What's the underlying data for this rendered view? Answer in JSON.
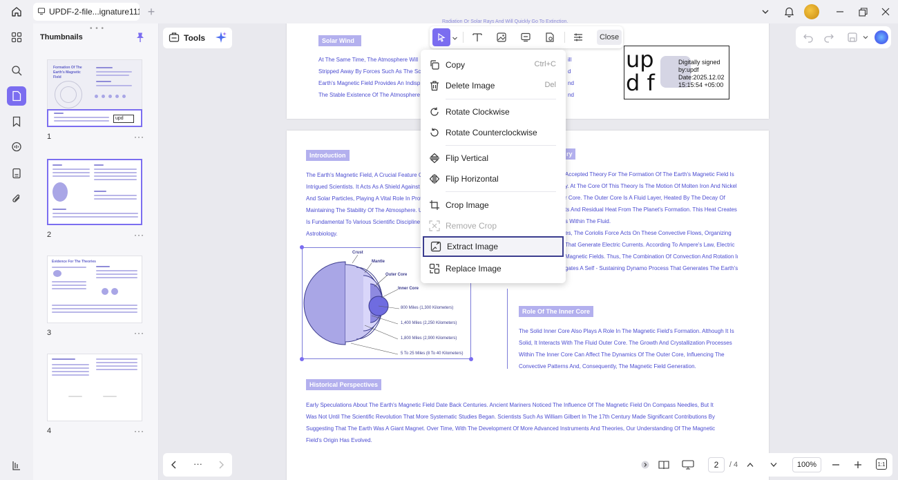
{
  "titlebar": {
    "tab_title": "UPDF-2-file...ignature111"
  },
  "thumbnails": {
    "title": "Thumbnails",
    "pages": [
      {
        "num": "1",
        "more": "···"
      },
      {
        "num": "2",
        "more": "···"
      },
      {
        "num": "3",
        "more": "···"
      },
      {
        "num": "4",
        "more": "···"
      }
    ],
    "thumb_texts": {
      "p1_title": "Formation Of The Earth's Magnetic Field",
      "p1_sig": "upd",
      "p3_title": "Evidence For The Theories"
    }
  },
  "tools": {
    "label": "Tools"
  },
  "edit_toolbar": {
    "close_label": "Close"
  },
  "context_menu": {
    "items": [
      {
        "label": "Copy",
        "shortcut": "Ctrl+C"
      },
      {
        "label": "Delete Image",
        "shortcut": "Del"
      },
      {
        "label": "Rotate Clockwise"
      },
      {
        "label": "Rotate Counterclockwise"
      },
      {
        "label": "Flip Vertical"
      },
      {
        "label": "Flip Horizontal"
      },
      {
        "label": "Crop Image"
      },
      {
        "label": "Remove Crop"
      },
      {
        "label": "Extract Image"
      },
      {
        "label": "Replace Image"
      }
    ]
  },
  "document": {
    "page1": {
      "heading": "Solar Wind",
      "top_fragment": "Radiation Or Solar Rays And Will Quickly Go To Extinction.",
      "lines": [
        "At The Same Time, The Atmosphere Will",
        "Stripped Away By Forces Such As The Sc",
        "Earth's Magnetic Field Provides An Indisp",
        "The Stable Existence Of The Atmosphere"
      ],
      "right_fragments": [
        "ill",
        "d",
        "nd",
        "nd"
      ]
    },
    "signature": {
      "updf": "upd f",
      "line1": "Digitally signed",
      "line2": "by:updf",
      "line3": "Date:2025.12.02",
      "line4": "15:15:54 +05:00"
    },
    "page2": {
      "intro_heading": "Introduction",
      "intro_lines": [
        "The Earth's Magnetic Field, A Crucial Feature C",
        "Intrigued Scientists. It Acts As A Shield Against",
        "And Solar Particles, Playing A Vital Role In Prote",
        "Maintaining The Stability Of The Atmosphere. U",
        "Is Fundamental To Various Scientific Discipline",
        "Astrobiology."
      ],
      "theory_heading_fragment": "ry",
      "theory_lines": [
        "Accepted Theory For The Formation Of The Earth's Magnetic Field Is",
        "y. At The Core Of This Theory Is The Motion Of Molten Iron And Nickel",
        "r Core. The Outer Core Is A Fluid Layer, Heated By The Decay Of",
        "ts And Residual Heat From The Planet's Formation. This Heat Creates",
        "s Within The Fluid.",
        "es, The Coriolis Force Acts On These Convective Flows, Organizing",
        "That Generate Electric Currents. According To Ampere's Law, Electric",
        "Magnetic Fields. Thus, The Combination Of Convection And Rotation In",
        "gates A Self - Sustaining Dynamo Process That Generates The Earth's"
      ],
      "diagram_labels": {
        "crust": "Crust",
        "mantle": "Mantle",
        "outer_core": "Outer Core",
        "inner_core": "Inner Core",
        "d1": "800 Miles (1,300 Kilometers)",
        "d2": "1,400 Miles (2,250 Kilometers)",
        "d3": "1,800 Miles (2,900 Kilometers)",
        "d4": "5 To 25 Miles (8 To 40 Kilometers)"
      },
      "inner_heading": "Role Of The Inner Core",
      "inner_lines": [
        "The Solid Inner Core Also Plays A Role In The Magnetic Field's Formation. Although It Is",
        "Solid, It Interacts With The Fluid Outer Core. The Growth And Crystallization Processes",
        "Within The Inner Core Can Affect The Dynamics Of The Outer Core, Influencing The",
        "Convective Patterns And, Consequently, The Magnetic Field Generation."
      ],
      "hist_heading": "Historical Perspectives",
      "hist_lines": [
        "Early Speculations About The Earth's Magnetic Field Date Back Centuries. Ancient Mariners Noticed The Influence Of The Magnetic Field On Compass Needles, But It",
        "Was Not Until The Scientific Revolution That More Systematic Studies Began. Scientists Such As William Gilbert In The 17th Century Made Significant Contributions By",
        "Suggesting That The Earth Was A Giant Magnet. Over Time, With The Development Of More Advanced Instruments And Theories, Our Understanding Of The Magnetic",
        "Field's Origin Has Evolved."
      ]
    }
  },
  "bottom_nav": {
    "more": "···"
  },
  "status": {
    "current_page": "2",
    "total_pages": "/ 4",
    "zoom": "100%",
    "fit_label": "1:1"
  },
  "colors": {
    "accent": "#7b6df0",
    "doc_text": "#4a4bd0",
    "heading_pill": "#b3b0ee",
    "highlight_border": "#3a3c8e"
  }
}
